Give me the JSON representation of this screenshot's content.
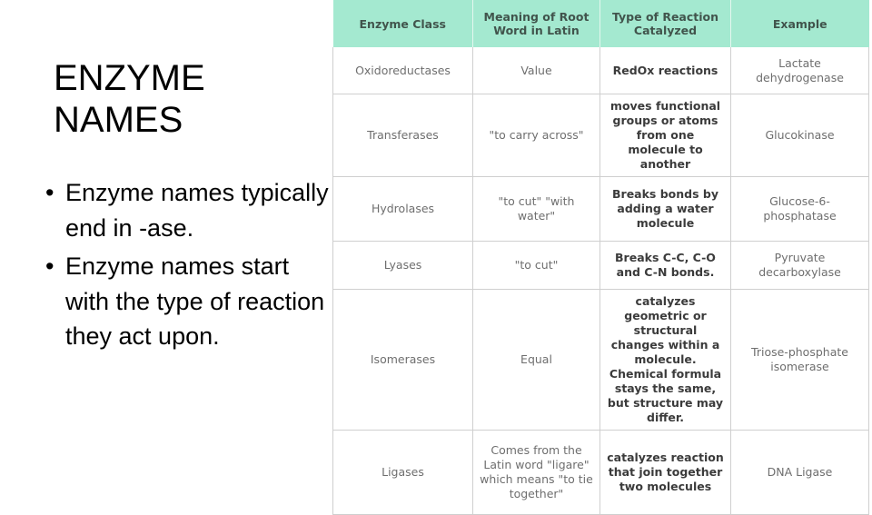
{
  "slide": {
    "title": "ENZYME\nNAMES",
    "bullet_marker": "•",
    "bullets": [
      "Enzyme names typically end in -ase.",
      "Enzyme names start with the type of reaction they act upon."
    ]
  },
  "table": {
    "header_bg": "#a4e9d0",
    "header_text_color": "#41544c",
    "body_text_color": "#6e6e6e",
    "emphasis_text_color": "#3b3b3b",
    "border_color": "#cfcfcf",
    "columns": [
      "Enzyme Class",
      "Meaning of Root Word in Latin",
      "Type of Reaction Catalyzed",
      "Example"
    ],
    "rows": [
      {
        "enzyme_class": "Oxidoreductases",
        "meaning": "Value",
        "reaction": "RedOx reactions",
        "example": "Lactate dehydrogenase"
      },
      {
        "enzyme_class": "Transferases",
        "meaning": "\"to carry across\"",
        "reaction": "moves functional groups or atoms from one molecule to another",
        "example": "Glucokinase"
      },
      {
        "enzyme_class": "Hydrolases",
        "meaning": "\"to cut\" \"with water\"",
        "reaction": "Breaks bonds by adding a water molecule",
        "example": "Glucose-6-phosphatase"
      },
      {
        "enzyme_class": "Lyases",
        "meaning": "\"to cut\"",
        "reaction": "Breaks C-C, C-O and C-N bonds.",
        "example": "Pyruvate decarboxylase"
      },
      {
        "enzyme_class": "Isomerases",
        "meaning": "Equal",
        "reaction": "catalyzes geometric or structural changes within a molecule. Chemical formula stays the same, but structure may differ.",
        "example": "Triose-phosphate isomerase"
      },
      {
        "enzyme_class": "Ligases",
        "meaning": "Comes from the Latin word \"ligare\" which means \"to tie together\"",
        "reaction": "catalyzes reaction that join together two molecules",
        "example": "DNA Ligase"
      }
    ]
  }
}
